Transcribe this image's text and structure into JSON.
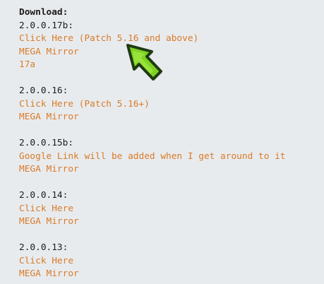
{
  "download": {
    "heading": "Download:",
    "releases": [
      {
        "version": "2.0.0.17b:",
        "links": [
          "Click Here (Patch 5.16 and above)",
          "MEGA Mirror",
          "17a"
        ]
      },
      {
        "version": "2.0.0.16:",
        "links": [
          "Click Here (Patch 5.16+)",
          "MEGA Mirror"
        ]
      },
      {
        "version": "2.0.0.15b:",
        "links": [
          "Google Link will be added when I get around to it",
          "MEGA Mirror"
        ]
      },
      {
        "version": "2.0.0.14:",
        "links": [
          "Click Here",
          "MEGA Mirror"
        ]
      },
      {
        "version": "2.0.0.13:",
        "links": [
          "Click Here",
          "MEGA Mirror"
        ]
      }
    ]
  },
  "colors": {
    "background": "#e8ebee",
    "text": "#1b1b1b",
    "link": "#d97b28",
    "cursor_fill": "#7ed321",
    "cursor_outline": "#1f3a12"
  },
  "icons": {
    "cursor": "green-arrow-cursor-icon"
  }
}
